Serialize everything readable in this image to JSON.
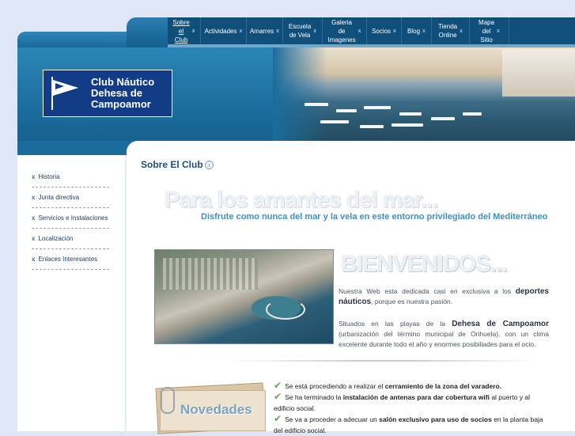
{
  "nav": {
    "items": [
      {
        "label": "Sobre el Club",
        "lines": [
          "Sobre",
          "el",
          "Club"
        ],
        "active": true
      },
      {
        "label": "Actividades",
        "lines": [
          "Actividades"
        ]
      },
      {
        "label": "Amarres",
        "lines": [
          "Amarres"
        ]
      },
      {
        "label": "Escuela de Vela",
        "lines": [
          "Escuela",
          "de Vela"
        ]
      },
      {
        "label": "Galeria de Imagenes",
        "lines": [
          "Galeria",
          "de",
          "Imagenes"
        ]
      },
      {
        "label": "Socios",
        "lines": [
          "Socios"
        ]
      },
      {
        "label": "Blog",
        "lines": [
          "Blog"
        ]
      },
      {
        "label": "Tienda Online",
        "lines": [
          "Tienda",
          "Online"
        ]
      },
      {
        "label": "Mapa del Sitio",
        "lines": [
          "Mapa",
          "del",
          "Sitio"
        ]
      }
    ],
    "bullet": "x"
  },
  "logo": {
    "line1": "Club Náutico",
    "line2": "Dehesa de",
    "line3": "Campoamor"
  },
  "sidebar": {
    "items": [
      {
        "label": "Historia"
      },
      {
        "label": "Junta directiva"
      },
      {
        "label": "Servicios e Instalaciones"
      },
      {
        "label": "Localización"
      },
      {
        "label": "Enlaces Interesantes"
      }
    ]
  },
  "main": {
    "section_title": "Sobre El Club",
    "slogan": "Para los amantes del mar...",
    "slogan_sub": "Disfrute como nunca del mar y la vela en este entorno privilegiado del Mediterráneo",
    "welcome": "BIENVENIDOS...",
    "p1_a": "Nuestra Web esta dedicada casi en exclusiva a los ",
    "p1_b": "deportes náuticos",
    "p1_c": ", porque es nuestra pasión.",
    "p2_a": "Situados en las playas de la ",
    "p2_b": "Dehesa de Campoamor",
    "p2_c": " (urbanización del término municipal de Orihuela), con un clima excelente durante todo el año y enormes posibiliades para el ocio."
  },
  "novedades": {
    "title": "Novedades",
    "items": [
      {
        "a": "Se está procediendo a realizar el ",
        "b": "cerramiento de la zona del varadero.",
        "c": ""
      },
      {
        "a": "Se ha terminado la ",
        "b": "instalación de antenas para dar cobertura wifi",
        "c": " al puerto y al edificio social."
      },
      {
        "a": "Se va a proceder a adecuar un ",
        "b": "salón exclusivo para uso de socios",
        "c": " en la planta baja del edificio social."
      }
    ]
  },
  "colors": {
    "nav_bg": "#0f4f7a",
    "banner_blue": "#1b6c9c",
    "logo_bg": "#123c86",
    "accent": "#3d91c4"
  }
}
